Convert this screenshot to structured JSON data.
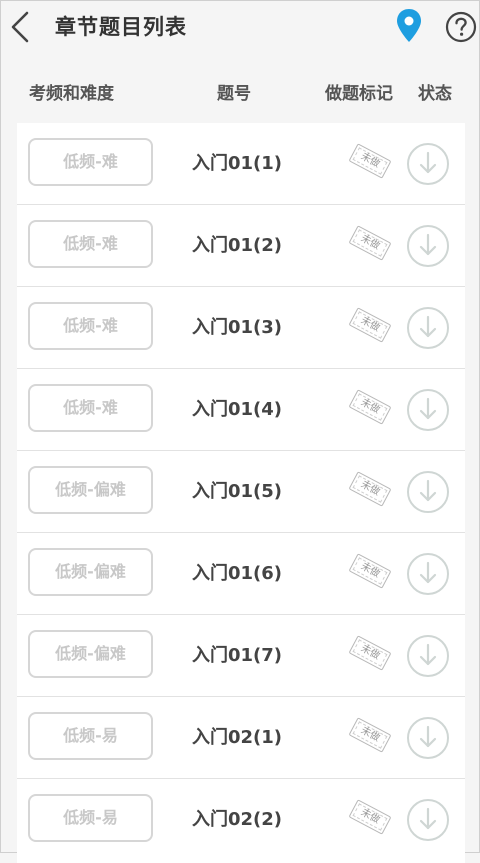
{
  "header": {
    "title": "章节题目列表"
  },
  "columns": {
    "difficulty": "考频和难度",
    "number": "题号",
    "mark": "做题标记",
    "status": "状态"
  },
  "items": [
    {
      "difficulty": "低频-难",
      "number": "入门01(1)",
      "mark": "未做"
    },
    {
      "difficulty": "低频-难",
      "number": "入门01(2)",
      "mark": "未做"
    },
    {
      "difficulty": "低频-难",
      "number": "入门01(3)",
      "mark": "未做"
    },
    {
      "difficulty": "低频-难",
      "number": "入门01(4)",
      "mark": "未做"
    },
    {
      "difficulty": "低频-偏难",
      "number": "入门01(5)",
      "mark": "未做"
    },
    {
      "difficulty": "低频-偏难",
      "number": "入门01(6)",
      "mark": "未做"
    },
    {
      "difficulty": "低频-偏难",
      "number": "入门01(7)",
      "mark": "未做"
    },
    {
      "difficulty": "低频-易",
      "number": "入门02(1)",
      "mark": "未做"
    },
    {
      "difficulty": "低频-易",
      "number": "入门02(2)",
      "mark": "未做"
    }
  ],
  "colors": {
    "accent": "#1e9ee0",
    "muted": "#c8c8c8"
  },
  "icons": {
    "back": "chevron-left-icon",
    "location": "location-pin-icon",
    "help": "help-circle-icon",
    "download": "download-circle-icon"
  }
}
